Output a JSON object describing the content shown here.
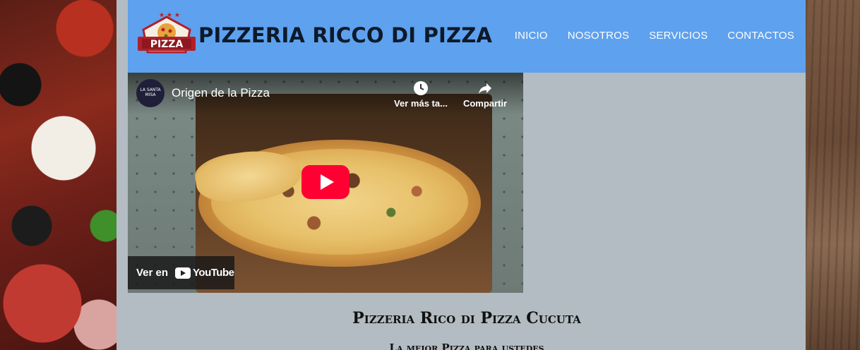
{
  "site": {
    "title": "PIZZERIA RICCO DI PIZZA",
    "logo_text": "PIZZA",
    "colors": {
      "header": "#5ea1ee",
      "page": "#b2bcc2",
      "nav_text": "#ffffff",
      "logo_red": "#b1202a"
    }
  },
  "nav": {
    "items": [
      {
        "label": "INICIO"
      },
      {
        "label": "NOSOTROS"
      },
      {
        "label": "SERVICIOS"
      },
      {
        "label": "CONTACTOS"
      }
    ]
  },
  "video": {
    "channel_avatar_text": "LA SANTA MISA",
    "title": "Origen de la Pizza",
    "watch_later_label": "Ver más ta...",
    "share_label": "Compartir",
    "watch_on_label": "Ver en",
    "youtube_label": "YouTube"
  },
  "content": {
    "heading": "Pizzeria Rico di Pizza Cucuta",
    "subheading": "La mejor Pizza para ustedes"
  }
}
